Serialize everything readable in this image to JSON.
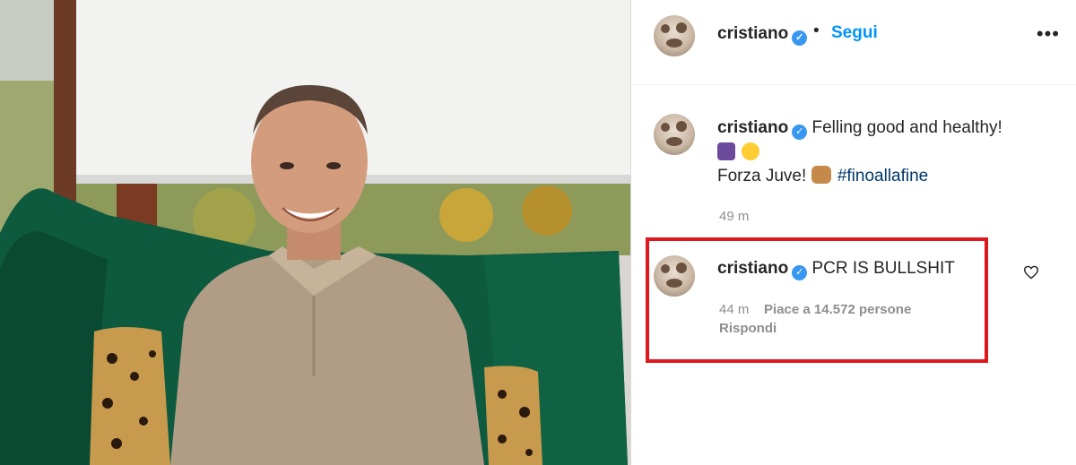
{
  "post": {
    "username": "cristiano",
    "follow_label": "Segui",
    "dot_separator": "•",
    "more_label": "•••"
  },
  "caption": {
    "username": "cristiano",
    "text": "Felling good and healthy!",
    "line2_prefix": "Forza Juve!",
    "hashtag": "#finoallafine",
    "time": "49 m"
  },
  "comment": {
    "username": "cristiano",
    "text": "PCR IS BULLSHIT",
    "time": "44 m",
    "likes": "Piace a 14.572 persone",
    "reply_label": "Rispondi"
  },
  "colors": {
    "accent": "#0095f6",
    "verified": "#3897f0",
    "highlight_box": "#e0161e"
  },
  "icons": {
    "verified": "verified-badge-icon",
    "heart": "heart-icon",
    "more": "more-options-icon"
  }
}
